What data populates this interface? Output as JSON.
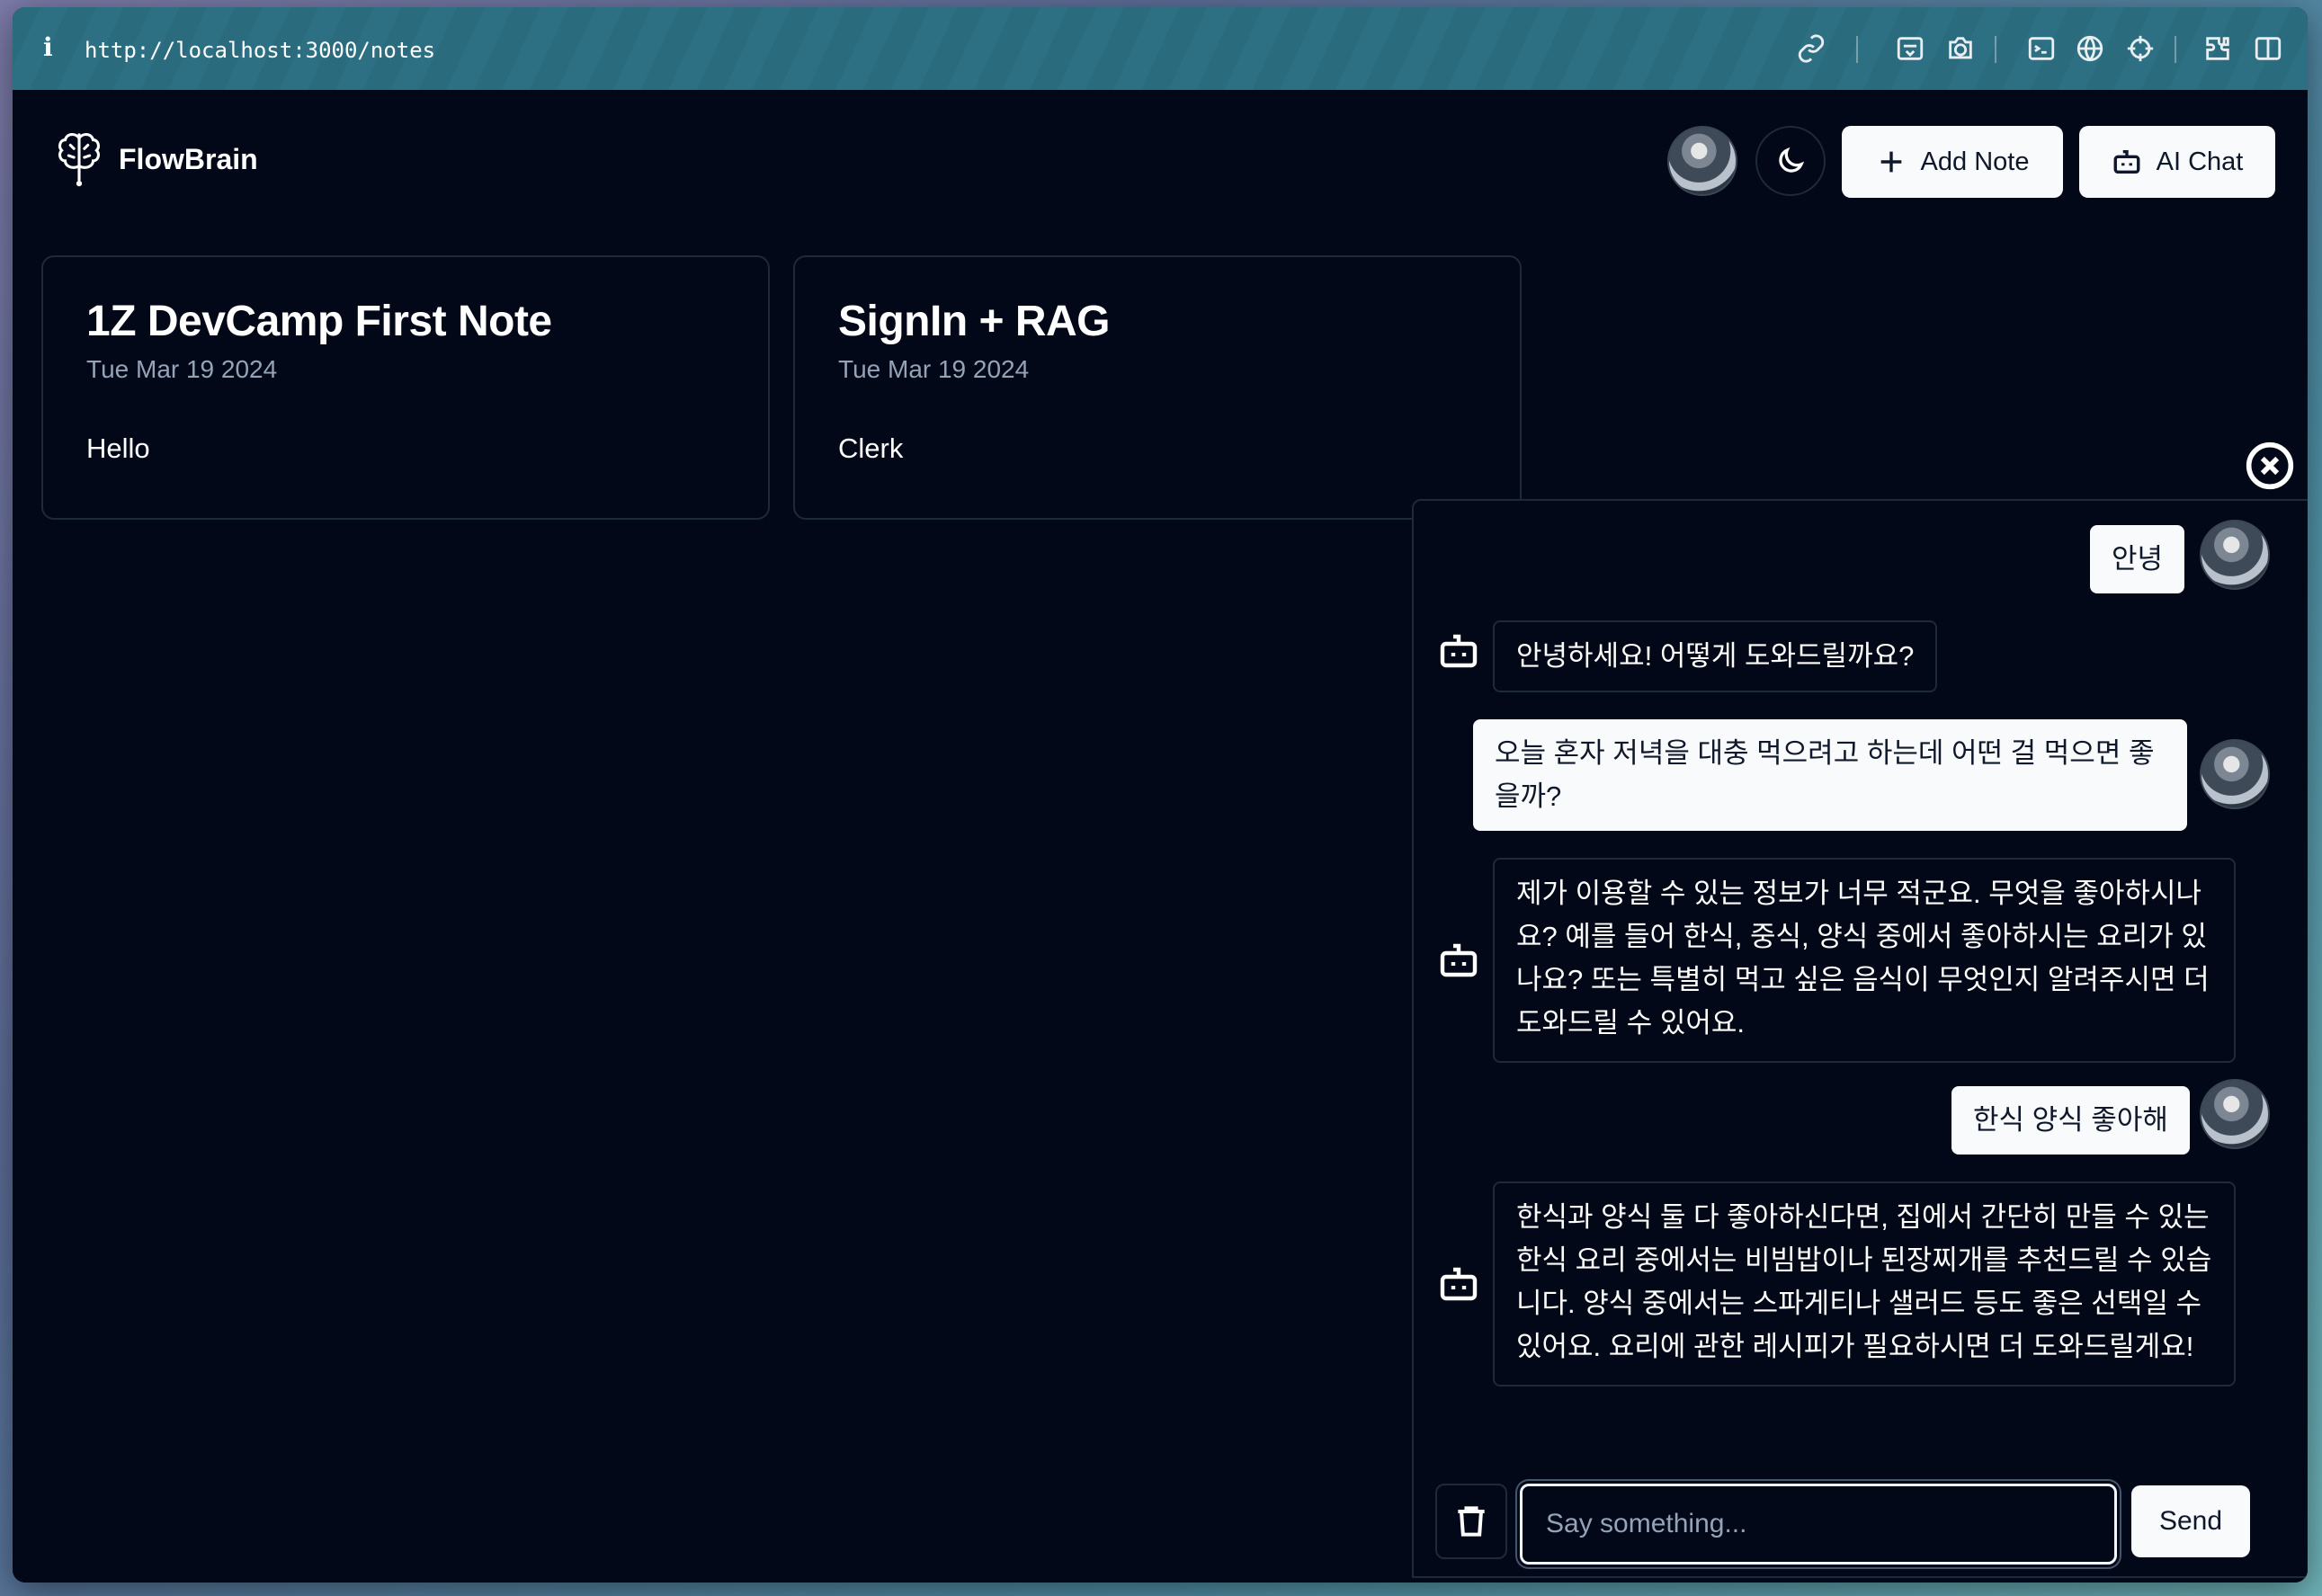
{
  "browser": {
    "info_glyph": "i",
    "url": "http://localhost:3000/notes",
    "toolbar_icons": [
      "link-icon",
      "responsive-icon",
      "camera-icon",
      "console-icon",
      "globe-icon",
      "crosshair-icon",
      "extensions-icon",
      "split-view-icon"
    ]
  },
  "header": {
    "brand_name": "FlowBrain",
    "add_note_label": "Add Note",
    "ai_chat_label": "AI Chat"
  },
  "notes": [
    {
      "title": "1Z DevCamp First Note",
      "date": "Tue Mar 19 2024",
      "body": "Hello"
    },
    {
      "title": "SignIn + RAG",
      "date": "Tue Mar 19 2024",
      "body": "Clerk"
    }
  ],
  "chat": {
    "messages": [
      {
        "role": "user",
        "text": "안녕"
      },
      {
        "role": "assistant",
        "text": "안녕하세요! 어떻게 도와드릴까요?"
      },
      {
        "role": "user",
        "line1": "오늘 혼자 저녁을 대충 먹으려고 하는데 어떤 걸 먹으면 좋",
        "line2": "을까?"
      },
      {
        "role": "assistant",
        "line1": "제가 이용할 수 있는 정보가 너무 적군요. 무엇을 좋아하시나",
        "line2": "요? 예를 들어 한식, 중식, 양식 중에서 좋아하시는 요리가 있",
        "line3": "나요? 또는 특별히 먹고 싶은 음식이 무엇인지 알려주시면 더",
        "line4": "도와드릴 수 있어요."
      },
      {
        "role": "user",
        "text": "한식 양식 좋아해"
      },
      {
        "role": "assistant",
        "line1": "한식과 양식 둘 다 좋아하신다면, 집에서 간단히 만들 수 있는",
        "line2": "한식 요리 중에서는 비빔밥이나 된장찌개를 추천드릴 수 있습",
        "line3": "니다. 양식 중에서는 스파게티나 샐러드 등도 좋은 선택일 수",
        "line4": "있어요. 요리에 관한 레시피가 필요하시면 더 도와드릴게요!"
      }
    ],
    "input_placeholder": "Say something...",
    "send_label": "Send"
  },
  "colors": {
    "background": "#020817",
    "border": "#1e293b",
    "muted_text": "#94a3b8",
    "button_light": "#f8fafc",
    "urlbar": "#2a6b7e"
  }
}
